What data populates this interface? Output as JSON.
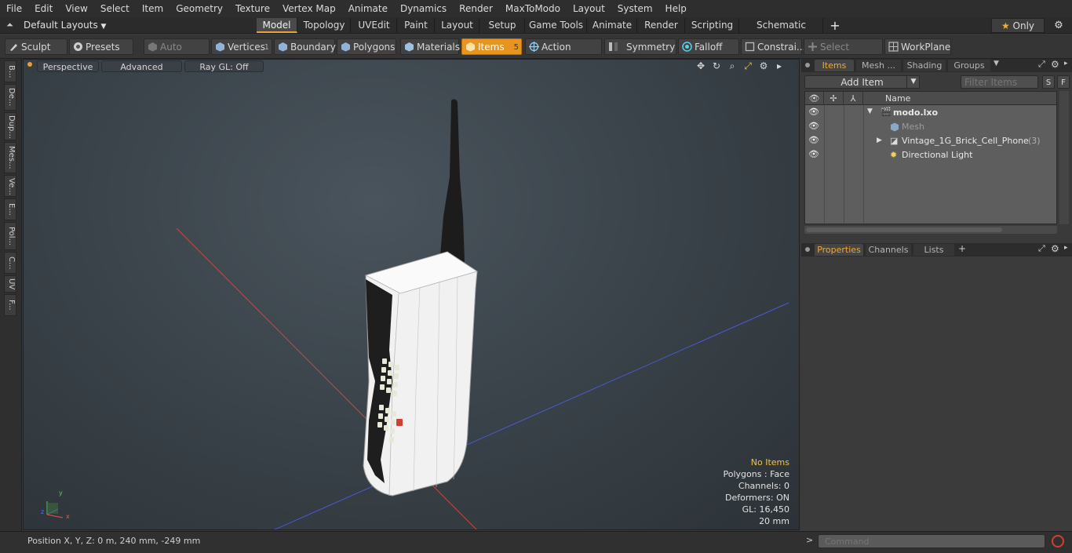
{
  "menu": [
    "File",
    "Edit",
    "View",
    "Select",
    "Item",
    "Geometry",
    "Texture",
    "Vertex Map",
    "Animate",
    "Dynamics",
    "Render",
    "MaxToModo",
    "Layout",
    "System",
    "Help"
  ],
  "layoutbar": {
    "layouts_label": "Default Layouts",
    "tabs": [
      "Model",
      "Topology",
      "UVEdit",
      "Paint",
      "Layout",
      "Setup",
      "Game Tools",
      "Animate",
      "Render",
      "Scripting",
      "Schematic Fusion"
    ],
    "active_tab": "Model",
    "add": "+",
    "only": "Only"
  },
  "toolbar": {
    "sculpt": "Sculpt",
    "presets": "Presets",
    "auto_select": "Auto Select",
    "vertices": "Vertices",
    "vertices_count": "1",
    "boundary": "Boundary",
    "polygons": "Polygons",
    "materials": "Materials",
    "items": "Items",
    "items_count": "5",
    "action_center": "Action Center",
    "symmetry": "Symmetry",
    "falloff": "Falloff",
    "constraints": "Constrai...",
    "select_through": "Select Through",
    "workplane": "WorkPlane"
  },
  "lefttabs": [
    "B...",
    "De...",
    "Dup...",
    "Mes...",
    "Ve...",
    "E...",
    "Pol...",
    "C...",
    "UV",
    "F..."
  ],
  "viewport": {
    "perspective": "Perspective",
    "advanced": "Advanced",
    "raygl": "Ray GL: Off",
    "info": {
      "no_items": "No Items",
      "polygons": "Polygons : Face",
      "channels": "Channels: 0",
      "deformers": "Deformers: ON",
      "gl": "GL: 16,450",
      "scale": "20 mm"
    },
    "axis_x": "x",
    "axis_y": "y",
    "axis_z": "z"
  },
  "items_panel": {
    "tabs": [
      "Items",
      "Mesh ...",
      "Shading",
      "Groups"
    ],
    "active_tab": "Items",
    "add_item": "Add Item",
    "filter_placeholder": "Filter Items",
    "s": "S",
    "f": "F",
    "col_name": "Name",
    "rows": [
      {
        "label": "modo.lxo",
        "bold": true
      },
      {
        "label": "Mesh",
        "dim": true
      },
      {
        "label": "Vintage_1G_Brick_Cell_Phone",
        "count": "(3)"
      },
      {
        "label": "Directional Light"
      }
    ]
  },
  "props_panel": {
    "tabs": [
      "Properties",
      "Channels",
      "Lists"
    ],
    "active_tab": "Properties",
    "add": "+"
  },
  "status": {
    "position": "Position X, Y, Z:  0 m, 240 mm, -249 mm",
    "command_placeholder": "Command"
  }
}
